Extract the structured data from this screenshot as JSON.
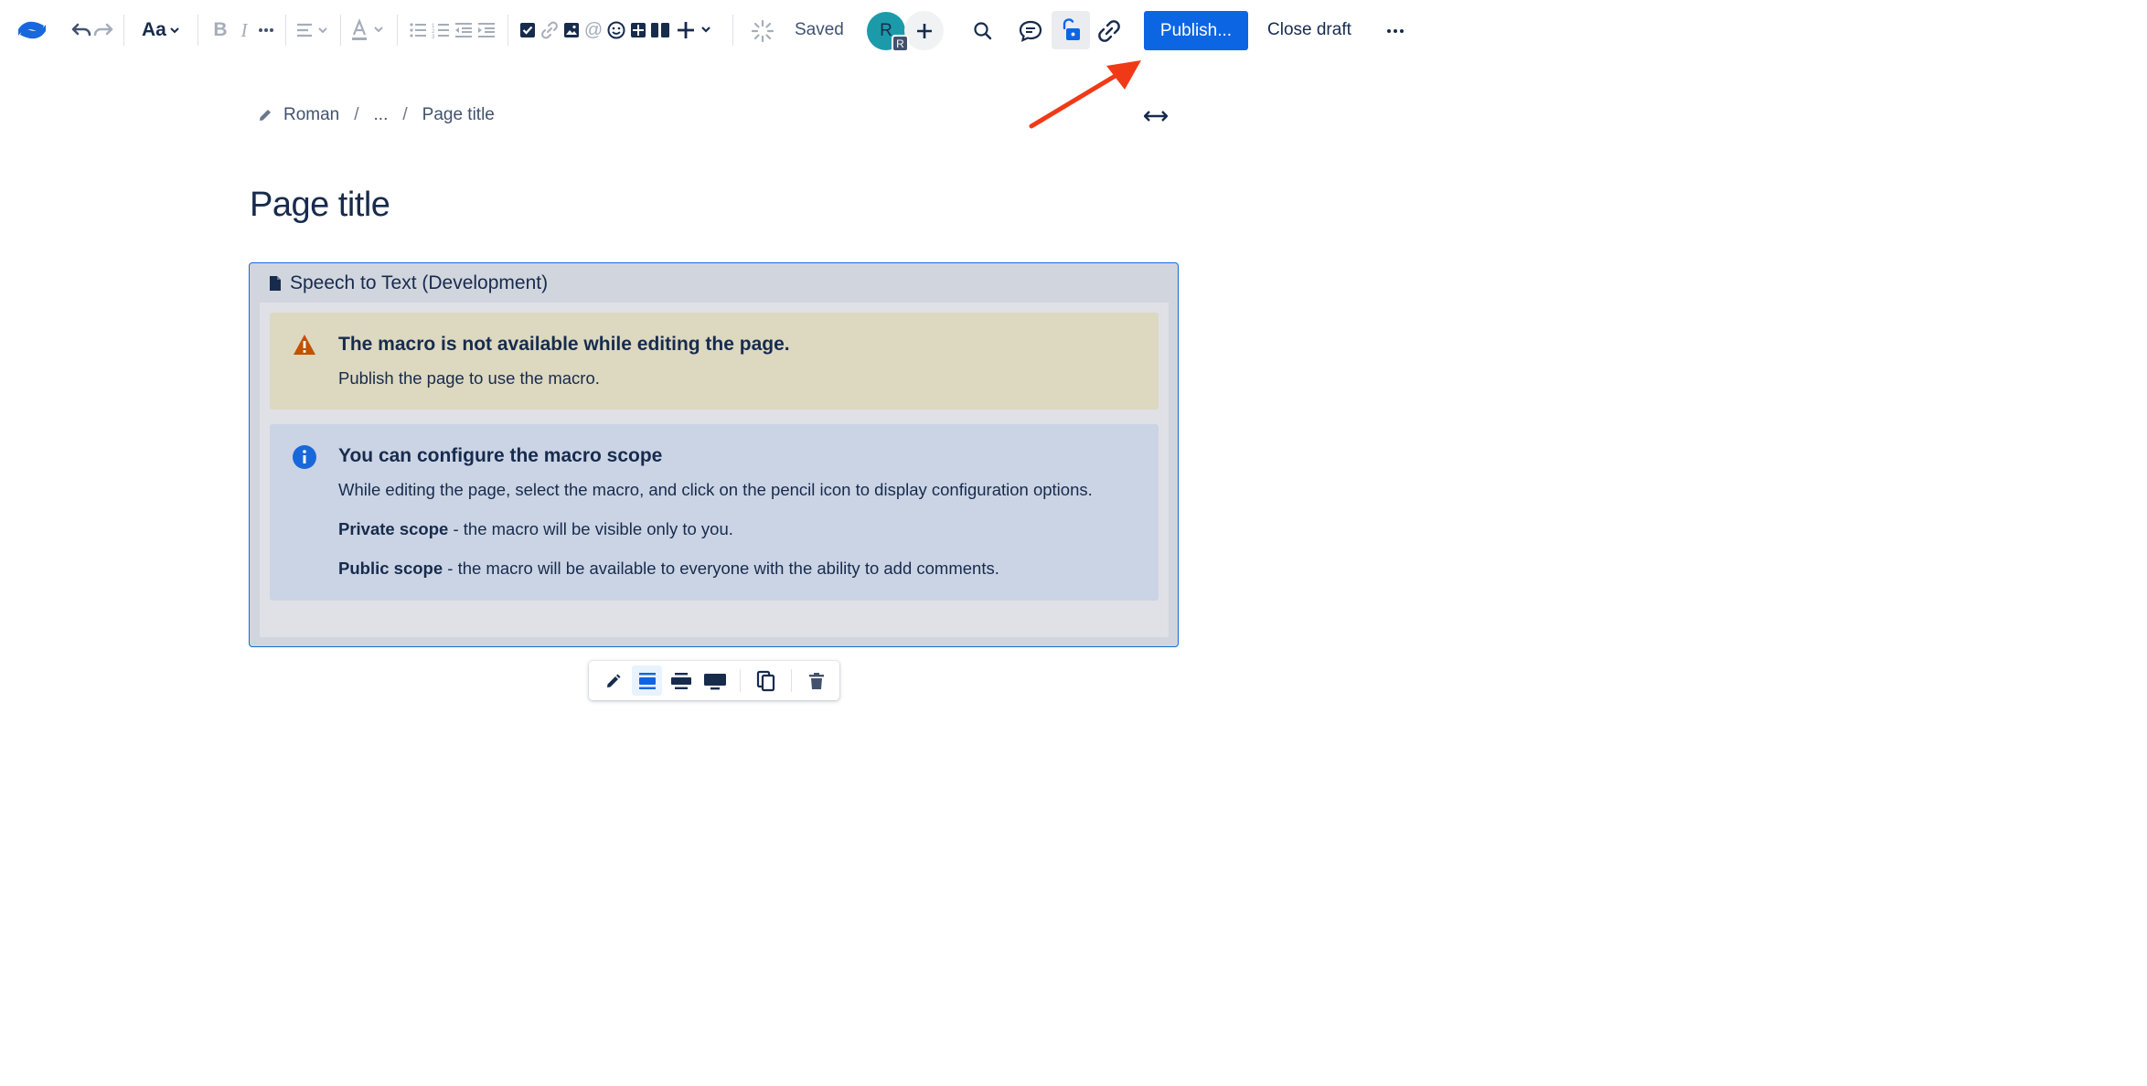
{
  "toolbar": {
    "text_style_label": "Aa",
    "saved_label": "Saved",
    "publish_label": "Publish...",
    "close_draft_label": "Close draft",
    "avatar_initial": "R",
    "avatar_badge": "R"
  },
  "breadcrumb": {
    "items": [
      "Roman",
      "...",
      "Page title"
    ]
  },
  "page": {
    "title": "Page title"
  },
  "macro": {
    "name": "Speech to Text (Development)",
    "warning": {
      "title": "The macro is not available while editing the page.",
      "text": "Publish the page to use the macro."
    },
    "info": {
      "title": "You can configure the macro scope",
      "text": "While editing the page, select the macro, and click on the pencil icon to display configuration options.",
      "private_label": "Private scope",
      "private_text": " - the macro will be visible only to you.",
      "public_label": "Public scope",
      "public_text": " - the macro will be available to everyone with the ability to add comments."
    }
  },
  "colors": {
    "publish": "#0c66e4",
    "annotation_arrow": "#f03a17",
    "warning_icon": "#c25100",
    "info_icon": "#1868db",
    "macro_border": "#1868db"
  }
}
